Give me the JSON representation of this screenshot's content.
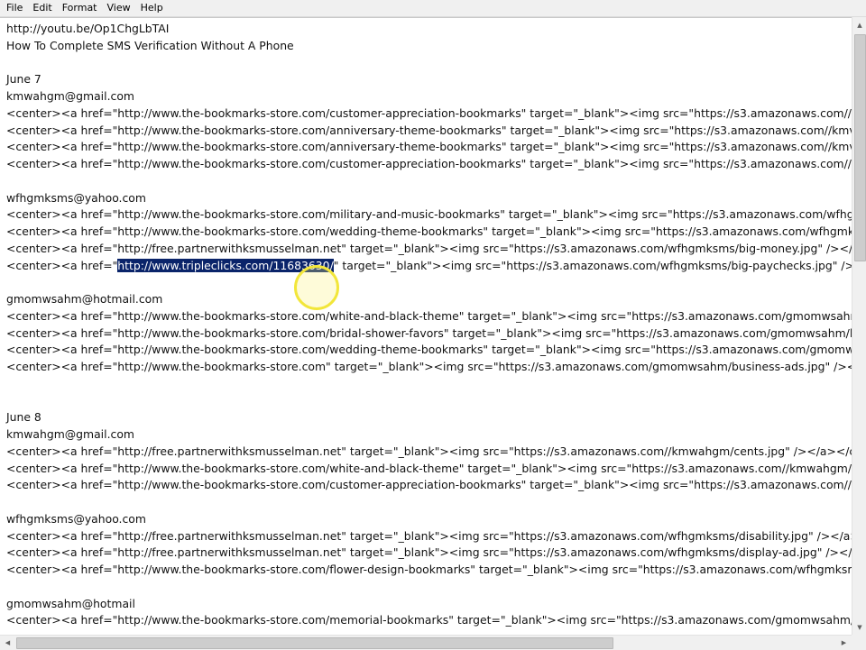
{
  "menubar": {
    "items": [
      "File",
      "Edit",
      "Format",
      "View",
      "Help"
    ]
  },
  "document": {
    "lines": [
      "http://youtu.be/Op1ChgLbTAI",
      "How To Complete SMS Verification Without A Phone",
      "",
      "June 7",
      "kmwahgm@gmail.com",
      "<center><a href=\"http://www.the-bookmarks-store.com/customer-appreciation-bookmarks\" target=\"_blank\"><img src=\"https://s3.amazonaws.com//",
      "<center><a href=\"http://www.the-bookmarks-store.com/anniversary-theme-bookmarks\" target=\"_blank\"><img src=\"https://s3.amazonaws.com//kmv",
      "<center><a href=\"http://www.the-bookmarks-store.com/anniversary-theme-bookmarks\" target=\"_blank\"><img src=\"https://s3.amazonaws.com//kmv",
      "<center><a href=\"http://www.the-bookmarks-store.com/customer-appreciation-bookmarks\" target=\"_blank\"><img src=\"https://s3.amazonaws.com//",
      "",
      "wfhgmksms@yahoo.com",
      "<center><a href=\"http://www.the-bookmarks-store.com/military-and-music-bookmarks\" target=\"_blank\"><img src=\"https://s3.amazonaws.com/wfhg",
      "<center><a href=\"http://www.the-bookmarks-store.com/wedding-theme-bookmarks\" target=\"_blank\"><img src=\"https://s3.amazonaws.com/wfhgmk",
      "<center><a href=\"http://free.partnerwithksmusselman.net\" target=\"_blank\"><img src=\"https://s3.amazonaws.com/wfhgmksms/big-money.jpg\" /></a",
      "<center><a href=\"http://www.tripleclicks.com/11683630/\" target=\"_blank\"><img src=\"https://s3.amazonaws.com/wfhgmksms/big-paychecks.jpg\" /><",
      "",
      "gmomwsahm@hotmail.com",
      "<center><a href=\"http://www.the-bookmarks-store.com/white-and-black-theme\" target=\"_blank\"><img src=\"https://s3.amazonaws.com/gmomwsahr",
      "<center><a href=\"http://www.the-bookmarks-store.com/bridal-shower-favors\" target=\"_blank\"><img src=\"https://s3.amazonaws.com/gmomwsahm/l",
      "<center><a href=\"http://www.the-bookmarks-store.com/wedding-theme-bookmarks\" target=\"_blank\"><img src=\"https://s3.amazonaws.com/gmomw",
      "<center><a href=\"http://www.the-bookmarks-store.com\" target=\"_blank\"><img src=\"https://s3.amazonaws.com/gmomwsahm/business-ads.jpg\" /></",
      "",
      "",
      "June 8",
      "kmwahgm@gmail.com",
      "<center><a href=\"http://free.partnerwithksmusselman.net\" target=\"_blank\"><img src=\"https://s3.amazonaws.com//kmwahgm/cents.jpg\" /></a></ce",
      "<center><a href=\"http://www.the-bookmarks-store.com/white-and-black-theme\" target=\"_blank\"><img src=\"https://s3.amazonaws.com//kmwahgm/",
      "<center><a href=\"http://www.the-bookmarks-store.com/customer-appreciation-bookmarks\" target=\"_blank\"><img src=\"https://s3.amazonaws.com//",
      "",
      "wfhgmksms@yahoo.com",
      "<center><a href=\"http://free.partnerwithksmusselman.net\" target=\"_blank\"><img src=\"https://s3.amazonaws.com/wfhgmksms/disability.jpg\" /></a>",
      "<center><a href=\"http://free.partnerwithksmusselman.net\" target=\"_blank\"><img src=\"https://s3.amazonaws.com/wfhgmksms/display-ad.jpg\" /></a>",
      "<center><a href=\"http://www.the-bookmarks-store.com/flower-design-bookmarks\" target=\"_blank\"><img src=\"https://s3.amazonaws.com/wfhgmksn",
      "",
      "gmomwsahm@hotmail",
      "<center><a href=\"http://www.the-bookmarks-store.com/memorial-bookmarks\" target=\"_blank\"><img src=\"https://s3.amazonaws.com/gmomwsahm/"
    ],
    "selection": {
      "line_index": 14,
      "text": "http://www.tripleclicks.com/11683630/"
    }
  },
  "colors": {
    "selection_background": "#0a246a",
    "selection_text": "#ffffff",
    "cursor_highlight": "#f2e63a"
  },
  "icons": {
    "scroll_up": "triangle-up-icon",
    "scroll_down": "triangle-down-icon",
    "scroll_left": "triangle-left-icon",
    "scroll_right": "triangle-right-icon"
  }
}
